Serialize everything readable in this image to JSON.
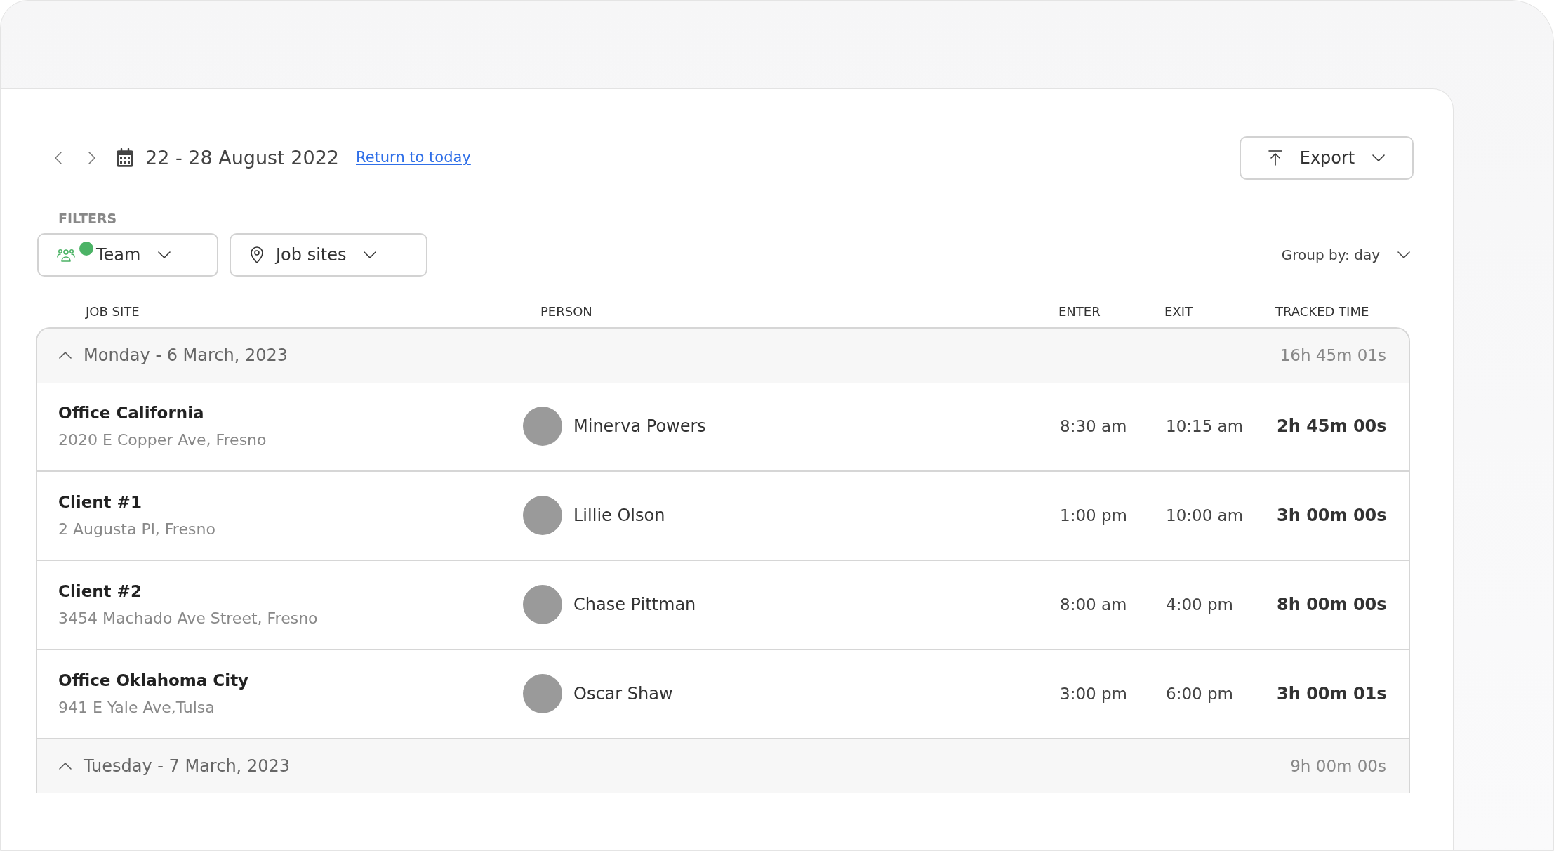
{
  "toolbar": {
    "date_range": "22 - 28 August 2022",
    "return_link": "Return to today",
    "export_button": "Export"
  },
  "filters": {
    "label": "FILTERS",
    "items": [
      {
        "kind": "team",
        "label": "Team",
        "active": true
      },
      {
        "kind": "location",
        "label": "Job sites",
        "active": false
      }
    ]
  },
  "group_by": "Group by: day",
  "table": {
    "columns": [
      "JOB SITE",
      "PERSON",
      "ENTER",
      "EXIT",
      "TRACKED TIME"
    ],
    "groups": [
      {
        "title": "Monday - 6 March, 2023",
        "total": "16h 45m 01s",
        "expanded": true,
        "rows": [
          {
            "site": "Office California",
            "address": "2020 E Copper Ave, Fresno",
            "person": "Minerva Powers",
            "enter": "8:30 am",
            "exit": "10:15 am",
            "tracked": "2h 45m 00s"
          },
          {
            "site": "Client #1",
            "address": "2 Augusta Pl, Fresno",
            "person": "Lillie Olson",
            "enter": "1:00 pm",
            "exit": "10:00 am",
            "tracked": "3h 00m 00s"
          },
          {
            "site": "Client #2",
            "address": "3454 Machado Ave Street, Fresno",
            "person": "Chase Pittman",
            "enter": "8:00 am",
            "exit": "4:00 pm",
            "tracked": "8h 00m 00s"
          },
          {
            "site": "Office Oklahoma City",
            "address": "941 E Yale Ave,Tulsa",
            "person": "Oscar Shaw",
            "enter": "3:00 pm",
            "exit": "6:00 pm",
            "tracked": "3h 00m 01s"
          }
        ]
      },
      {
        "title": "Tuesday - 7 March, 2023",
        "total": "9h 00m 00s",
        "expanded": true
      }
    ]
  }
}
